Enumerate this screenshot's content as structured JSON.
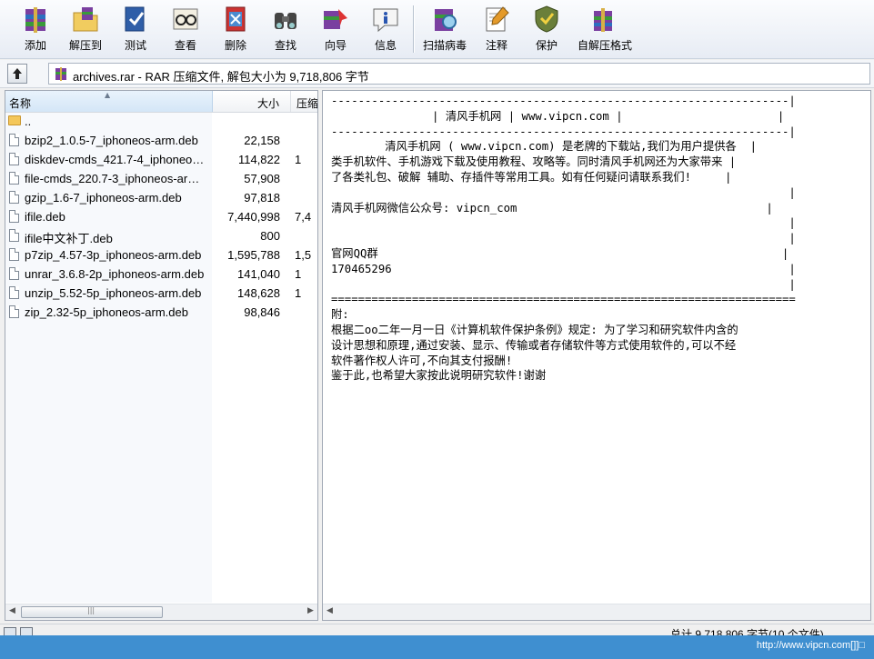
{
  "toolbar": {
    "buttons": [
      {
        "label": "添加",
        "icon": "add-archive-icon"
      },
      {
        "label": "解压到",
        "icon": "extract-to-icon"
      },
      {
        "label": "测试",
        "icon": "test-icon"
      },
      {
        "label": "查看",
        "icon": "view-icon"
      },
      {
        "label": "删除",
        "icon": "delete-icon"
      },
      {
        "label": "查找",
        "icon": "find-icon"
      },
      {
        "label": "向导",
        "icon": "wizard-icon"
      },
      {
        "label": "信息",
        "icon": "info-icon"
      },
      {
        "label": "扫描病毒",
        "icon": "virus-scan-icon"
      },
      {
        "label": "注释",
        "icon": "comment-icon"
      },
      {
        "label": "保护",
        "icon": "protect-icon"
      },
      {
        "label": "自解压格式",
        "icon": "sfx-icon"
      }
    ]
  },
  "address": {
    "text": "archives.rar - RAR 压缩文件, 解包大小为 9,718,806 字节"
  },
  "file_list": {
    "columns": {
      "name": "名称",
      "size": "大小",
      "packed": "压缩"
    },
    "rows": [
      {
        "name": "..",
        "size": "",
        "packed": "",
        "type": "folder"
      },
      {
        "name": "bzip2_1.0.5-7_iphoneos-arm.deb",
        "size": "22,158",
        "packed": "",
        "type": "file"
      },
      {
        "name": "diskdev-cmds_421.7-4_iphoneos-arm.deb",
        "size": "114,822",
        "packed": "1",
        "type": "file"
      },
      {
        "name": "file-cmds_220.7-3_iphoneos-arm.deb",
        "size": "57,908",
        "packed": "",
        "type": "file"
      },
      {
        "name": "gzip_1.6-7_iphoneos-arm.deb",
        "size": "97,818",
        "packed": "",
        "type": "file"
      },
      {
        "name": "ifile.deb",
        "size": "7,440,998",
        "packed": "7,4",
        "type": "file"
      },
      {
        "name": "ifile中文补丁.deb",
        "size": "800",
        "packed": "",
        "type": "file"
      },
      {
        "name": "p7zip_4.57-3p_iphoneos-arm.deb",
        "size": "1,595,788",
        "packed": "1,5",
        "type": "file"
      },
      {
        "name": "unrar_3.6.8-2p_iphoneos-arm.deb",
        "size": "141,040",
        "packed": "1",
        "type": "file"
      },
      {
        "name": "unzip_5.52-5p_iphoneos-arm.deb",
        "size": "148,628",
        "packed": "1",
        "type": "file"
      },
      {
        "name": "zip_2.32-5p_iphoneos-arm.deb",
        "size": "98,846",
        "packed": "",
        "type": "file"
      }
    ]
  },
  "comment": {
    "lines": [
      "--------------------------------------------------------------------|",
      "               | 清风手机网 | www.vipcn.com |                       |",
      "--------------------------------------------------------------------|",
      "        清风手机网 ( www.vipcn.com) 是老牌的下载站,我们为用户提供各  |",
      "类手机软件、手机游戏下载及使用教程、攻略等。同时清风手机网还为大家带来 |",
      "了各类礼包、破解 辅助、存插件等常用工具。如有任何疑问请联系我们!     |",
      "                                                                    |",
      "清风手机网微信公众号: vipcn_com                                     |",
      "                                                                    |",
      "                                                                    |",
      "官网QQ群                                                            |",
      "170465296                                                           |",
      "                                                                    |",
      "=====================================================================",
      "附:",
      "根据二oo二年一月一日《计算机软件保护条例》规定: 为了学习和研究软件内含的",
      "设计思想和原理,通过安装、显示、传输或者存储软件等方式使用软件的,可以不经",
      "软件著作权人许可,不向其支付报酬!",
      "鉴于此,也希望大家按此说明研究软件!谢谢"
    ]
  },
  "status": {
    "summary": "总计 9,718,806 字节(10 个文件)"
  },
  "watermark": "http://www.vipcn.com[]]□"
}
